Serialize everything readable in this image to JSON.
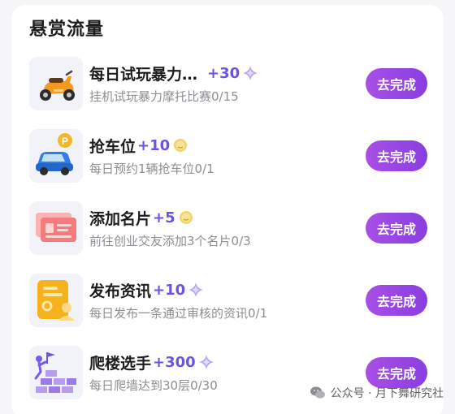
{
  "section": {
    "title": "悬赏流量"
  },
  "tasks": [
    {
      "title": "每日试玩暴力…",
      "reward": "+30",
      "reward_icon": "sparkle-icon",
      "description": "挂机试玩暴力摩托比赛0/15",
      "button_label": "去完成",
      "icon": "scooter-icon"
    },
    {
      "title": "抢车位",
      "reward": "+10",
      "reward_icon": "coin-icon",
      "description": "每日预约1辆抢车位0/1",
      "button_label": "去完成",
      "icon": "parking-car-icon"
    },
    {
      "title": "添加名片",
      "reward": "+5",
      "reward_icon": "coin-icon",
      "description": "前往创业交友添加3个名片0/3",
      "button_label": "去完成",
      "icon": "business-card-icon"
    },
    {
      "title": "发布资讯",
      "reward": "+10",
      "reward_icon": "sparkle-icon",
      "description": "每日发布一条通过审核的资讯0/1",
      "button_label": "去完成",
      "icon": "news-document-icon"
    },
    {
      "title": "爬楼选手",
      "reward": "+300",
      "reward_icon": "sparkle-icon",
      "description": "每日爬墙达到30层0/30",
      "button_label": "去完成",
      "icon": "wall-climber-icon"
    }
  ],
  "watermark": {
    "text": "公众号 · 月下舞研究社",
    "icon": "wechat-icon"
  },
  "colors": {
    "accent": "#6b54e0",
    "button": "#9a46e4",
    "text_primary": "#1c1c1e",
    "text_secondary": "#8e8e93"
  }
}
